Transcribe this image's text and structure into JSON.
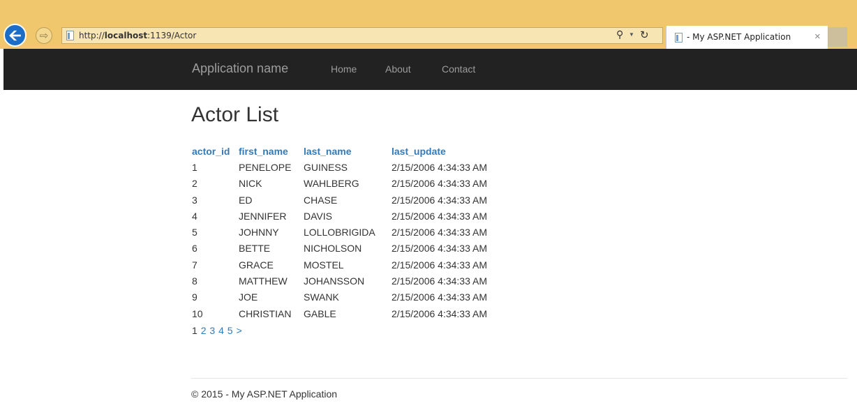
{
  "browser": {
    "url_prefix": "http://",
    "url_host": "localhost",
    "url_rest": ":1139/Actor",
    "tab_title": "- My ASP.NET Application",
    "back_icon": "back-arrow-icon",
    "forward_icon": "forward-arrow-icon"
  },
  "navbar": {
    "brand": "Application name",
    "links": [
      "Home",
      "About",
      "Contact"
    ],
    "background": "#222222",
    "link_color": "#9d9d9d"
  },
  "page": {
    "title": "Actor List"
  },
  "table": {
    "columns": [
      "actor_id",
      "first_name",
      "last_name",
      "last_update"
    ],
    "rows": [
      [
        "1",
        "PENELOPE",
        "GUINESS",
        "2/15/2006 4:34:33 AM"
      ],
      [
        "2",
        "NICK",
        "WAHLBERG",
        "2/15/2006 4:34:33 AM"
      ],
      [
        "3",
        "ED",
        "CHASE",
        "2/15/2006 4:34:33 AM"
      ],
      [
        "4",
        "JENNIFER",
        "DAVIS",
        "2/15/2006 4:34:33 AM"
      ],
      [
        "5",
        "JOHNNY",
        "LOLLOBRIGIDA",
        "2/15/2006 4:34:33 AM"
      ],
      [
        "6",
        "BETTE",
        "NICHOLSON",
        "2/15/2006 4:34:33 AM"
      ],
      [
        "7",
        "GRACE",
        "MOSTEL",
        "2/15/2006 4:34:33 AM"
      ],
      [
        "8",
        "MATTHEW",
        "JOHANSSON",
        "2/15/2006 4:34:33 AM"
      ],
      [
        "9",
        "JOE",
        "SWANK",
        "2/15/2006 4:34:33 AM"
      ],
      [
        "10",
        "CHRISTIAN",
        "GABLE",
        "2/15/2006 4:34:33 AM"
      ]
    ],
    "pager": {
      "current": "1",
      "links": [
        "2",
        "3",
        "4",
        "5",
        ">"
      ]
    },
    "link_color": "#337ab7"
  },
  "footer": {
    "text": "© 2015 - My ASP.NET Application"
  }
}
